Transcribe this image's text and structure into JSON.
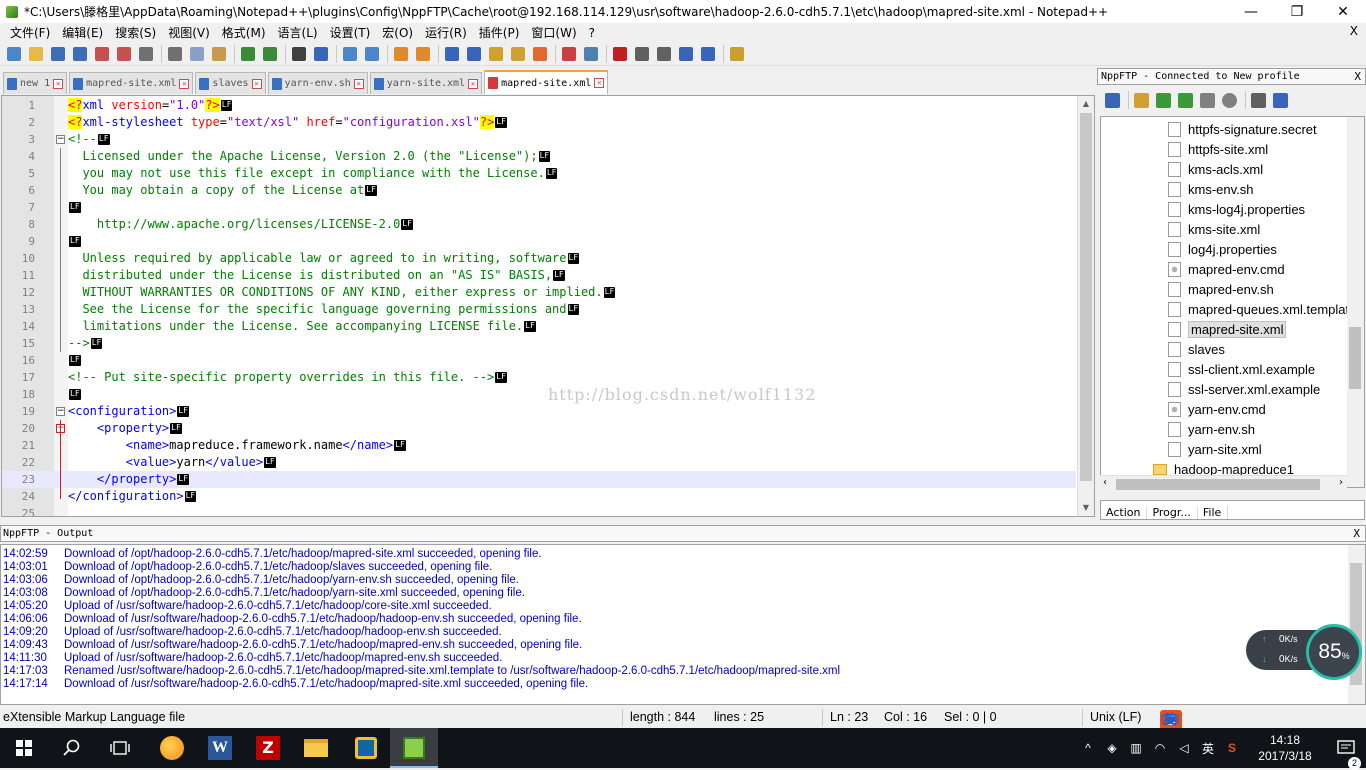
{
  "window": {
    "title": "*C:\\Users\\滕格里\\AppData\\Roaming\\Notepad++\\plugins\\Config\\NppFTP\\Cache\\root@192.168.114.129\\usr\\software\\hadoop-2.6.0-cdh5.7.1\\etc\\hadoop\\mapred-site.xml - Notepad++",
    "minimize": "—",
    "restore": "❐",
    "close": "✕"
  },
  "menu": {
    "items": [
      "文件(F)",
      "编辑(E)",
      "搜索(S)",
      "视图(V)",
      "格式(M)",
      "语言(L)",
      "设置(T)",
      "宏(O)",
      "运行(R)",
      "插件(P)",
      "窗口(W)",
      "?"
    ],
    "close": "X"
  },
  "toolbar": {
    "icons": [
      "new-file-icon",
      "open-file-icon",
      "save-icon",
      "save-all-icon",
      "close-icon",
      "close-all-icon",
      "print-icon",
      "cut-icon",
      "copy-icon",
      "paste-icon",
      "undo-icon",
      "redo-icon",
      "find-icon",
      "replace-icon",
      "zoom-in-icon",
      "zoom-out-icon",
      "sync-v-icon",
      "sync-h-icon",
      "wrap-icon",
      "show-all-chars-icon",
      "indent-guide-icon",
      "doc-map-icon",
      "function-list-icon",
      "folder-workspace-icon",
      "monitor-icon",
      "record-macro-icon",
      "stop-macro-icon",
      "play-macro-icon",
      "run-macro-multiple-icon",
      "save-macro-icon",
      "nppftp-icon"
    ]
  },
  "tabs": [
    {
      "label": "new 1",
      "active": false,
      "icon": "blue"
    },
    {
      "label": "mapred-site.xml",
      "active": false,
      "icon": "blue"
    },
    {
      "label": "slaves",
      "active": false,
      "icon": "blue"
    },
    {
      "label": "yarn-env.sh",
      "active": false,
      "icon": "blue"
    },
    {
      "label": "yarn-site.xml",
      "active": false,
      "icon": "blue"
    },
    {
      "label": "mapred-site.xml",
      "active": true,
      "icon": "red"
    }
  ],
  "editor": {
    "lf_marker": "LF",
    "watermark": "http://blog.csdn.net/wolf1132",
    "current_line": 23,
    "lines": [
      {
        "n": "1",
        "segs": [
          [
            "pi",
            "<?"
          ],
          [
            "tg",
            "xml "
          ],
          [
            "at",
            "version"
          ],
          [
            "tx",
            "="
          ],
          [
            "av",
            "\"1.0\""
          ],
          [
            "pi",
            "?>"
          ]
        ]
      },
      {
        "n": "2",
        "segs": [
          [
            "pi",
            "<?"
          ],
          [
            "tg",
            "xml-stylesheet "
          ],
          [
            "at",
            "type"
          ],
          [
            "tx",
            "="
          ],
          [
            "av",
            "\"text/xsl\" "
          ],
          [
            "at",
            "href"
          ],
          [
            "tx",
            "="
          ],
          [
            "av",
            "\"configuration.xsl\""
          ],
          [
            "pi",
            "?>"
          ]
        ]
      },
      {
        "n": "3",
        "segs": [
          [
            "cm",
            "<!--"
          ]
        ]
      },
      {
        "n": "4",
        "segs": [
          [
            "cm",
            "  Licensed under the Apache License, Version 2.0 (the \"License\");"
          ]
        ]
      },
      {
        "n": "5",
        "segs": [
          [
            "cm",
            "  you may not use this file except in compliance with the License."
          ]
        ]
      },
      {
        "n": "6",
        "segs": [
          [
            "cm",
            "  You may obtain a copy of the License at"
          ]
        ]
      },
      {
        "n": "7",
        "segs": []
      },
      {
        "n": "8",
        "segs": [
          [
            "cm",
            "    http://www.apache.org/licenses/LICENSE-2.0"
          ]
        ]
      },
      {
        "n": "9",
        "segs": []
      },
      {
        "n": "10",
        "segs": [
          [
            "cm",
            "  Unless required by applicable law or agreed to in writing, software"
          ]
        ]
      },
      {
        "n": "11",
        "segs": [
          [
            "cm",
            "  distributed under the License is distributed on an \"AS IS\" BASIS,"
          ]
        ]
      },
      {
        "n": "12",
        "segs": [
          [
            "cm",
            "  WITHOUT WARRANTIES OR CONDITIONS OF ANY KIND, either express or implied."
          ]
        ]
      },
      {
        "n": "13",
        "segs": [
          [
            "cm",
            "  See the License for the specific language governing permissions and"
          ]
        ]
      },
      {
        "n": "14",
        "segs": [
          [
            "cm",
            "  limitations under the License. See accompanying LICENSE file."
          ]
        ]
      },
      {
        "n": "15",
        "segs": [
          [
            "cm",
            "-->"
          ]
        ]
      },
      {
        "n": "16",
        "segs": []
      },
      {
        "n": "17",
        "segs": [
          [
            "cm",
            "<!-- Put site-specific property overrides in this file. -->"
          ]
        ]
      },
      {
        "n": "18",
        "segs": []
      },
      {
        "n": "19",
        "segs": [
          [
            "tg",
            "<configuration>"
          ]
        ]
      },
      {
        "n": "20",
        "segs": [
          [
            "tg",
            "    <property>"
          ]
        ]
      },
      {
        "n": "21",
        "segs": [
          [
            "tg",
            "        <name>"
          ],
          [
            "tx",
            "mapreduce.framework.name"
          ],
          [
            "tg",
            "</name>"
          ]
        ]
      },
      {
        "n": "22",
        "segs": [
          [
            "tg",
            "        <value>"
          ],
          [
            "tx",
            "yarn"
          ],
          [
            "tg",
            "</value>"
          ]
        ]
      },
      {
        "n": "23",
        "segs": [
          [
            "tg",
            "    </property>"
          ]
        ]
      },
      {
        "n": "24",
        "segs": [
          [
            "tg",
            "</configuration>"
          ]
        ]
      },
      {
        "n": "25",
        "segs": [],
        "nolf": true
      }
    ]
  },
  "nppftp": {
    "header": "NppFTP - Connected to New profile",
    "close": "X",
    "tool_icons": [
      "connect-icon",
      "open-directory-icon",
      "download-icon",
      "upload-icon",
      "refresh-icon",
      "abort-icon",
      "settings-icon",
      "message-window-icon"
    ],
    "files": [
      {
        "name": "httpfs-signature.secret",
        "type": "file"
      },
      {
        "name": "httpfs-site.xml",
        "type": "file"
      },
      {
        "name": "kms-acls.xml",
        "type": "file"
      },
      {
        "name": "kms-env.sh",
        "type": "file"
      },
      {
        "name": "kms-log4j.properties",
        "type": "file"
      },
      {
        "name": "kms-site.xml",
        "type": "file"
      },
      {
        "name": "log4j.properties",
        "type": "file"
      },
      {
        "name": "mapred-env.cmd",
        "type": "cmd"
      },
      {
        "name": "mapred-env.sh",
        "type": "file"
      },
      {
        "name": "mapred-queues.xml.template",
        "type": "file"
      },
      {
        "name": "mapred-site.xml",
        "type": "file",
        "selected": true
      },
      {
        "name": "slaves",
        "type": "file"
      },
      {
        "name": "ssl-client.xml.example",
        "type": "file"
      },
      {
        "name": "ssl-server.xml.example",
        "type": "file"
      },
      {
        "name": "yarn-env.cmd",
        "type": "cmd"
      },
      {
        "name": "yarn-env.sh",
        "type": "file"
      },
      {
        "name": "yarn-site.xml",
        "type": "file"
      },
      {
        "name": "hadoop-mapreduce1",
        "type": "folder"
      }
    ],
    "queue_columns": [
      "Action",
      "Progr...",
      "File"
    ]
  },
  "output": {
    "header": "NppFTP - Output",
    "close": "X",
    "lines": [
      {
        "time": "14:02:59",
        "msg": "Download of /opt/hadoop-2.6.0-cdh5.7.1/etc/hadoop/mapred-site.xml succeeded, opening file."
      },
      {
        "time": "14:03:01",
        "msg": "Download of /opt/hadoop-2.6.0-cdh5.7.1/etc/hadoop/slaves succeeded, opening file."
      },
      {
        "time": "14:03:06",
        "msg": "Download of /opt/hadoop-2.6.0-cdh5.7.1/etc/hadoop/yarn-env.sh succeeded, opening file."
      },
      {
        "time": "14:03:08",
        "msg": "Download of /opt/hadoop-2.6.0-cdh5.7.1/etc/hadoop/yarn-site.xml succeeded, opening file."
      },
      {
        "time": "14:05:20",
        "msg": "Upload of /usr/software/hadoop-2.6.0-cdh5.7.1/etc/hadoop/core-site.xml succeeded."
      },
      {
        "time": "14:06:06",
        "msg": "Download of /usr/software/hadoop-2.6.0-cdh5.7.1/etc/hadoop/hadoop-env.sh succeeded, opening file."
      },
      {
        "time": "14:09:20",
        "msg": "Upload of /usr/software/hadoop-2.6.0-cdh5.7.1/etc/hadoop/hadoop-env.sh succeeded."
      },
      {
        "time": "14:09:43",
        "msg": "Download of /usr/software/hadoop-2.6.0-cdh5.7.1/etc/hadoop/mapred-env.sh succeeded, opening file."
      },
      {
        "time": "14:11:30",
        "msg": "Upload of /usr/software/hadoop-2.6.0-cdh5.7.1/etc/hadoop/mapred-env.sh succeeded."
      },
      {
        "time": "14:17:03",
        "msg": "Renamed /usr/software/hadoop-2.6.0-cdh5.7.1/etc/hadoop/mapred-site.xml.template to /usr/software/hadoop-2.6.0-cdh5.7.1/etc/hadoop/mapred-site.xml"
      },
      {
        "time": "14:17:14",
        "msg": "Download of /usr/software/hadoop-2.6.0-cdh5.7.1/etc/hadoop/mapred-site.xml succeeded, opening file."
      }
    ]
  },
  "netwidget": {
    "up": "0",
    "down": "0",
    "unit": "K/s",
    "percent": "85",
    "percent_sign": "%"
  },
  "status": {
    "filetype": "eXtensible Markup Language file",
    "length": "length : 844",
    "lines": "lines : 25",
    "ln": "Ln : 23",
    "col": "Col : 16",
    "sel": "Sel : 0 | 0",
    "eol": "Unix (LF)"
  },
  "ime": {
    "logo": "S",
    "lang": "英"
  },
  "taskbar": {
    "apps": [
      "start-icon",
      "search-icon",
      "task-view-icon",
      "browser-icon",
      "word-icon",
      "filezilla-icon",
      "file-explorer-icon",
      "virtualbox-icon",
      "notepadpp-icon"
    ],
    "tray_lang": "英",
    "time": "14:18",
    "date": "2017/3/18",
    "notifications": "2"
  },
  "colors": {
    "accent": "#f2a33a",
    "tag": "#0000ff",
    "attr": "#ff0000",
    "value": "#8000ff",
    "comment": "#008000",
    "output": "#0000cc",
    "gauge": "#23bfa6"
  }
}
